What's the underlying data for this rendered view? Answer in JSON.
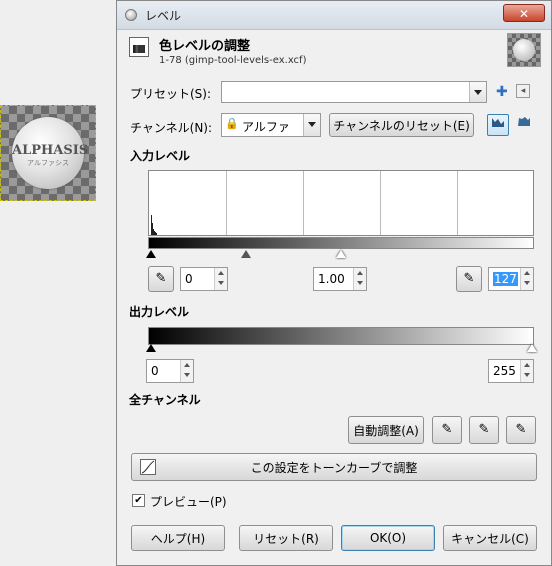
{
  "canvas": {
    "logo_text": "ALPHASIS",
    "logo_sub": "アルファシス"
  },
  "window": {
    "title": "レベル",
    "close_symbol": "✕"
  },
  "header": {
    "title": "色レベルの調整",
    "subtitle": "1-78 (gimp-tool-levels-ex.xcf)"
  },
  "preset": {
    "label": "プリセット(S):",
    "value": "",
    "add_symbol": "✚",
    "menu_symbol": "◂"
  },
  "channel": {
    "label": "チャンネル(N):",
    "value": "アルファ",
    "reset_button": "チャンネルのリセット(E)",
    "icon_symbol": "🔒"
  },
  "input_levels": {
    "heading": "入力レベル",
    "low": "0",
    "gamma": "1.00",
    "high": "127"
  },
  "output_levels": {
    "heading": "出力レベル",
    "low": "0",
    "high": "255"
  },
  "all_channels": {
    "heading": "全チャンネル",
    "auto_button": "自動調整(A)"
  },
  "curves_button": "この設定をトーンカーブで調整",
  "preview": {
    "label": "プレビュー(P)",
    "checked": true,
    "check_symbol": "✔"
  },
  "buttons": {
    "help": "ヘルプ(H)",
    "reset": "リセット(R)",
    "ok": "OK(O)",
    "cancel": "キャンセル(C)"
  },
  "icons": {
    "eyedropper": "✎"
  }
}
